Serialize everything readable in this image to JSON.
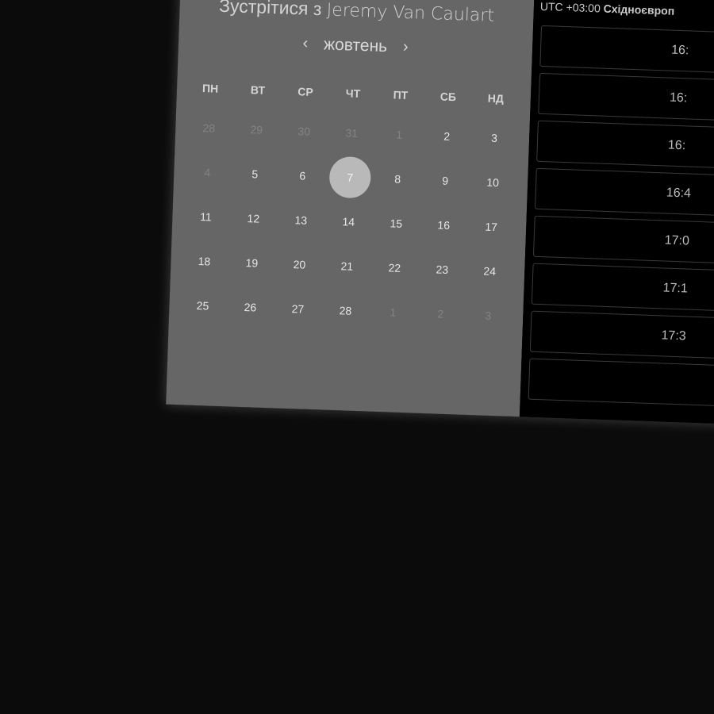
{
  "calendar": {
    "title_prefix": "Зустрітися з",
    "host_name": "Jeremy Van Caulart",
    "month": "жовтень",
    "prev_symbol": "‹",
    "next_symbol": "›",
    "weekdays": [
      "ПН",
      "ВТ",
      "СР",
      "ЧТ",
      "ПТ",
      "СБ",
      "НД"
    ],
    "weeks": [
      [
        "28",
        "29",
        "30",
        "31",
        "1",
        "2",
        "3"
      ],
      [
        "4",
        "5",
        "6",
        "7",
        "8",
        "9",
        "10"
      ],
      [
        "11",
        "12",
        "13",
        "14",
        "15",
        "16",
        "17"
      ],
      [
        "18",
        "19",
        "20",
        "21",
        "22",
        "23",
        "24"
      ],
      [
        "25",
        "26",
        "27",
        "28",
        "1",
        "2",
        "3"
      ]
    ],
    "selected_day": "7"
  },
  "timeslots": {
    "timezone_offset": "UTC +03:00",
    "timezone_name": "Східноєвроп",
    "slots": [
      "16:",
      "16:",
      "16:",
      "16:4",
      "17:0",
      "17:1",
      "17:3",
      ""
    ]
  },
  "colors": {
    "calendar_panel": "#666666",
    "slots_panel": "#000000",
    "selected_circle": "#b9b9b9",
    "page_background": "#0b0b0b"
  }
}
